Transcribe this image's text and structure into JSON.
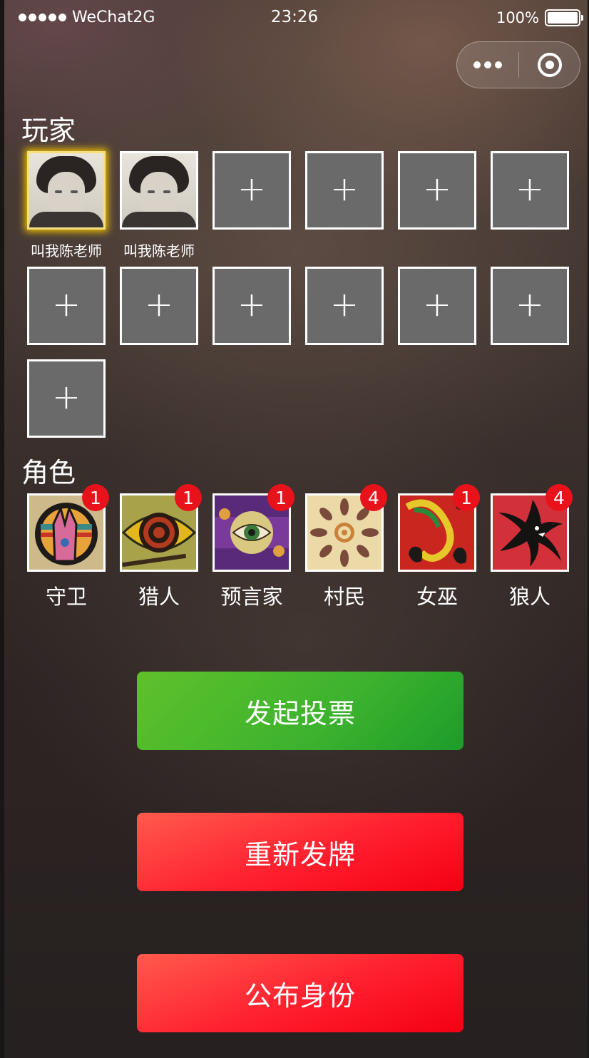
{
  "status_bar": {
    "carrier": "WeChat2G",
    "time": "23:26",
    "battery": "100%"
  },
  "players": {
    "title": "玩家",
    "list": [
      {
        "name": "叫我陈老师",
        "has_avatar": true
      },
      {
        "name": "叫我陈老师",
        "has_avatar": true
      }
    ],
    "empty_slot_symbol": "+"
  },
  "roles": {
    "title": "角色",
    "list": [
      {
        "name": "守卫",
        "count": "1",
        "icon": "guard-card-icon"
      },
      {
        "name": "猎人",
        "count": "1",
        "icon": "hunter-card-icon"
      },
      {
        "name": "预言家",
        "count": "1",
        "icon": "seer-card-icon"
      },
      {
        "name": "村民",
        "count": "4",
        "icon": "villager-card-icon"
      },
      {
        "name": "女巫",
        "count": "1",
        "icon": "witch-card-icon"
      },
      {
        "name": "狼人",
        "count": "4",
        "icon": "werewolf-card-icon"
      }
    ]
  },
  "actions": {
    "vote": "发起投票",
    "redeal": "重新发牌",
    "reveal": "公布身份"
  },
  "colors": {
    "vote_button": "#3cb22e",
    "action_button": "#ff1f2e",
    "badge": "#e8121b",
    "host_glow": "#f0c000"
  }
}
